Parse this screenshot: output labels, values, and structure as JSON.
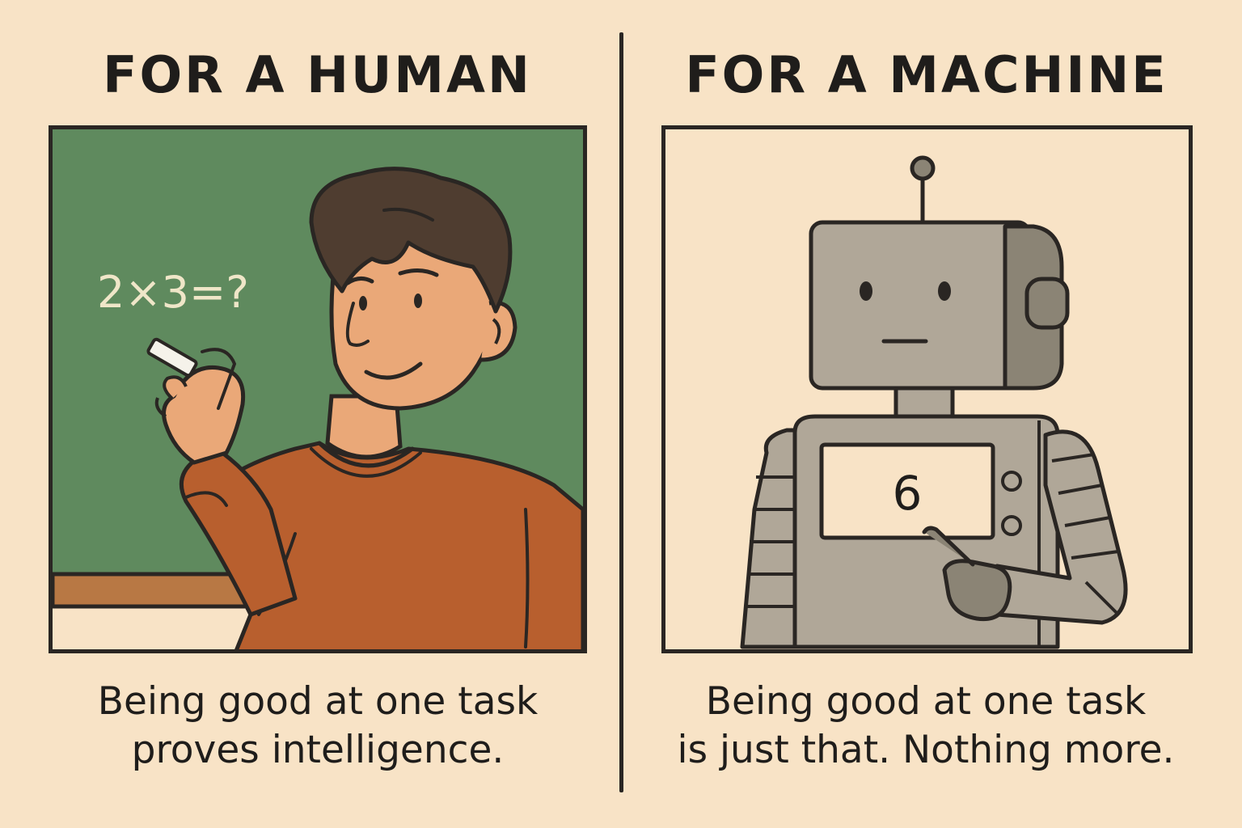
{
  "left_panel": {
    "heading": "FOR A HUMAN",
    "equation": "2×3=?",
    "caption_line1": "Being good at one task",
    "caption_line2": "proves intelligence."
  },
  "right_panel": {
    "heading": "FOR A MACHINE",
    "screen_value": "6",
    "caption_line1": "Being good at one task",
    "caption_line2": "is just that. Nothing more."
  },
  "colors": {
    "background": "#f8e3c6",
    "chalkboard": "#5f8a5e",
    "sweater": "#b85f2e",
    "skin": "#eaa878",
    "hair": "#4f3d30",
    "robot_body": "#b0a798",
    "robot_dark": "#8b8475",
    "outline": "#2a2623"
  },
  "icons": [
    "chalk-icon",
    "robot-antenna-icon"
  ]
}
